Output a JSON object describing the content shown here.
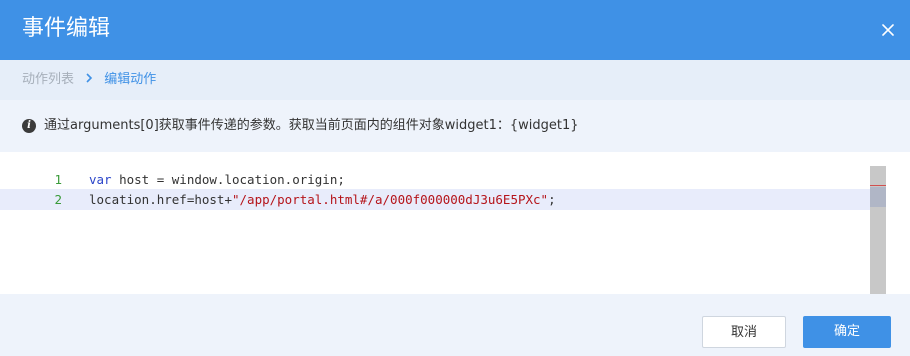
{
  "dialog": {
    "title": "事件编辑",
    "close_icon": "close-icon"
  },
  "breadcrumb": {
    "parent": "动作列表",
    "separator_icon": "chevron-right-icon",
    "current": "编辑动作"
  },
  "hint": {
    "icon": "info-icon",
    "icon_glyph": "i",
    "text": "通过arguments[0]获取事件传递的参数。获取当前页面内的组件对象widget1：{widget1}"
  },
  "editor": {
    "lines": [
      {
        "number": "1",
        "keyword": "var",
        "rest": " host = window.location.origin;"
      },
      {
        "number": "2",
        "before": "location.href=host+",
        "string": "\"/app/portal.html#/a/000f000000dJ3u6E5PXc\"",
        "after": ";"
      }
    ]
  },
  "footer": {
    "cancel_label": "取消",
    "ok_label": "确定"
  },
  "colors": {
    "header_bg": "#3f91e6",
    "accent": "#3f91e6",
    "panel_bg": "#eef3fb",
    "active_line": "#e8ecfb"
  }
}
